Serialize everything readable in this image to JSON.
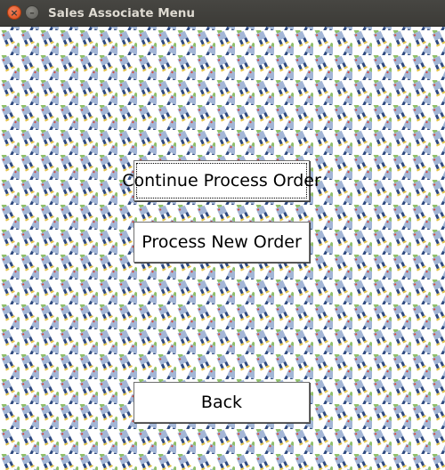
{
  "window": {
    "title": "Sales Associate Menu",
    "controls": {
      "close_icon": "close-icon",
      "minimize_icon": "minimize-icon"
    }
  },
  "background": {
    "pattern_icon": "person-tile-icon",
    "colors": {
      "body": "#a3b6d6",
      "head": "#8fbf6a",
      "legs": "#2f4a80",
      "feet": "#e3c34a",
      "accent": "#d4473c"
    }
  },
  "menu": {
    "continue_label": "Continue Process Order",
    "new_order_label": "Process New Order",
    "back_label": "Back"
  },
  "colors": {
    "titlebar": "#3c3b37",
    "title_text": "#dfdbd2",
    "close_button": "#dd4814",
    "button_bg": "#ffffff",
    "button_border": "#6f6f6f"
  }
}
